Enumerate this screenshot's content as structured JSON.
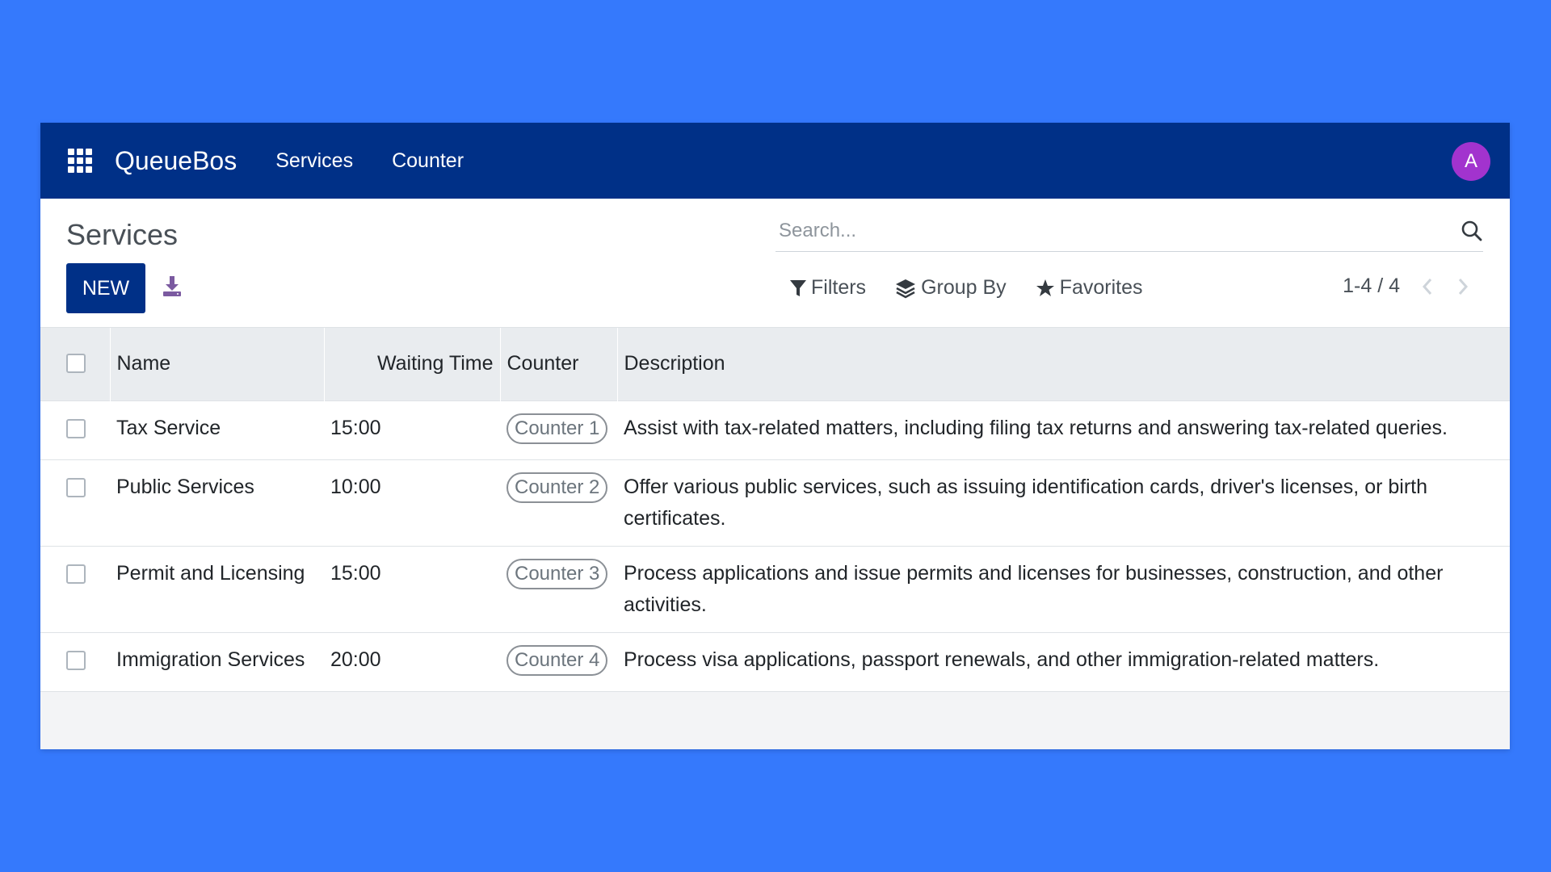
{
  "navbar": {
    "app_name": "QueueBos",
    "menu": [
      "Services",
      "Counter"
    ],
    "avatar_letter": "A",
    "avatar_color": "#a233ce",
    "background": "#003087"
  },
  "control_panel": {
    "title": "Services",
    "new_label": "NEW",
    "search_placeholder": "Search...",
    "filters_label": "Filters",
    "group_by_label": "Group By",
    "favorites_label": "Favorites",
    "pager": "1-4 / 4"
  },
  "table": {
    "columns": [
      "Name",
      "Waiting Time",
      "Counter",
      "Description"
    ],
    "rows": [
      {
        "name": "Tax Service",
        "waiting_time": "15:00",
        "counter": "Counter 1",
        "description": "Assist with tax-related matters, including filing tax returns and answering tax-related queries."
      },
      {
        "name": "Public Services",
        "waiting_time": "10:00",
        "counter": "Counter 2",
        "description": "Offer various public services, such as issuing identification cards, driver's licenses, or birth certificates."
      },
      {
        "name": "Permit and Licensing",
        "waiting_time": "15:00",
        "counter": "Counter 3",
        "description": "Process applications and issue permits and licenses for businesses, construction, and other activities."
      },
      {
        "name": "Immigration Services",
        "waiting_time": "20:00",
        "counter": "Counter 4",
        "description": "Process visa applications, passport renewals, and other immigration-related matters."
      }
    ]
  },
  "colors": {
    "page_background": "#3579fc",
    "primary": "#003087",
    "header_row": "#e9ecef"
  }
}
